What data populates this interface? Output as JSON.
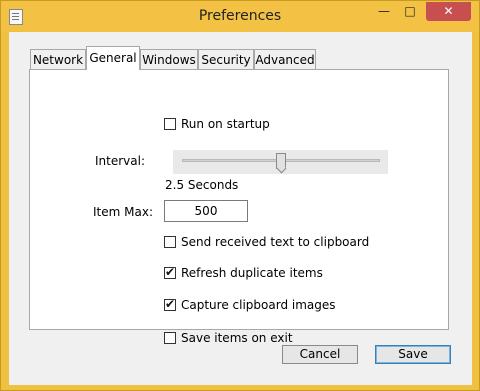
{
  "window": {
    "title": "Preferences"
  },
  "tabs": [
    {
      "label": "Network"
    },
    {
      "label": "General"
    },
    {
      "label": "Windows"
    },
    {
      "label": "Security"
    },
    {
      "label": "Advanced"
    }
  ],
  "active_tab": "General",
  "general": {
    "run_on_startup": {
      "label": "Run on startup",
      "checked": false
    },
    "interval": {
      "label": "Interval:",
      "value_text": "2.5 Seconds",
      "level": 0.5
    },
    "item_max": {
      "label": "Item Max:",
      "value": "500"
    },
    "send_received_text": {
      "label": "Send received text to clipboard",
      "checked": false
    },
    "refresh_duplicates": {
      "label": "Refresh duplicate items",
      "checked": true
    },
    "capture_images": {
      "label": "Capture clipboard images",
      "checked": true
    },
    "save_on_exit": {
      "label": "Save items on exit",
      "checked": false
    }
  },
  "buttons": {
    "cancel": "Cancel",
    "save": "Save"
  },
  "colors": {
    "titlebar": "#f3c244",
    "close": "#c74f4f",
    "panel": "#ffffff",
    "client": "#f0f0f0"
  },
  "icons": {
    "app": "notepad-icon"
  }
}
